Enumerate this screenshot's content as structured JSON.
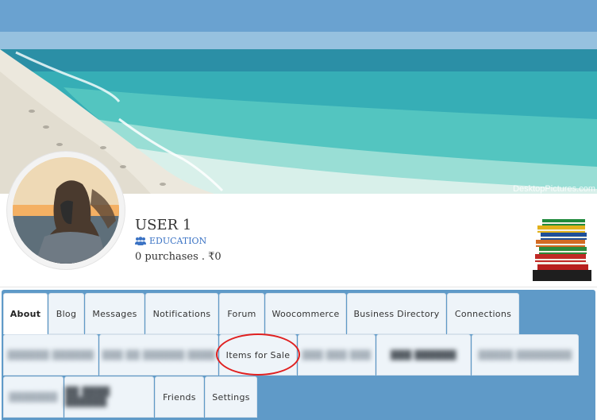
{
  "cover": {
    "watermark": "DesktopPictures.com"
  },
  "profile": {
    "name": "USER 1",
    "member_type": "EDUCATION",
    "purchases": "0 purchases . ₹0"
  },
  "tabs_row1": [
    {
      "label": "About",
      "active": true
    },
    {
      "label": "Blog"
    },
    {
      "label": "Messages"
    },
    {
      "label": "Notifications"
    },
    {
      "label": "Forum"
    },
    {
      "label": "Woocommerce"
    },
    {
      "label": "Business Directory"
    },
    {
      "label": "Connections"
    }
  ],
  "tabs_row2": [
    {
      "label": "",
      "blurred": true
    },
    {
      "label": "",
      "blurred": true
    },
    {
      "label": "Items for Sale",
      "highlighted": true
    },
    {
      "label": "",
      "blurred": true
    },
    {
      "label": "",
      "blurred": true
    },
    {
      "label": "",
      "blurred": true
    }
  ],
  "tabs_row3": [
    {
      "label": "",
      "blurred": true
    },
    {
      "label": "",
      "blurred": true
    },
    {
      "label": "Friends"
    },
    {
      "label": "Settings"
    }
  ],
  "colors": {
    "tab_panel_bg": "#5f9ac8",
    "link_blue": "#3b73c4",
    "highlight_red": "#e02020"
  }
}
